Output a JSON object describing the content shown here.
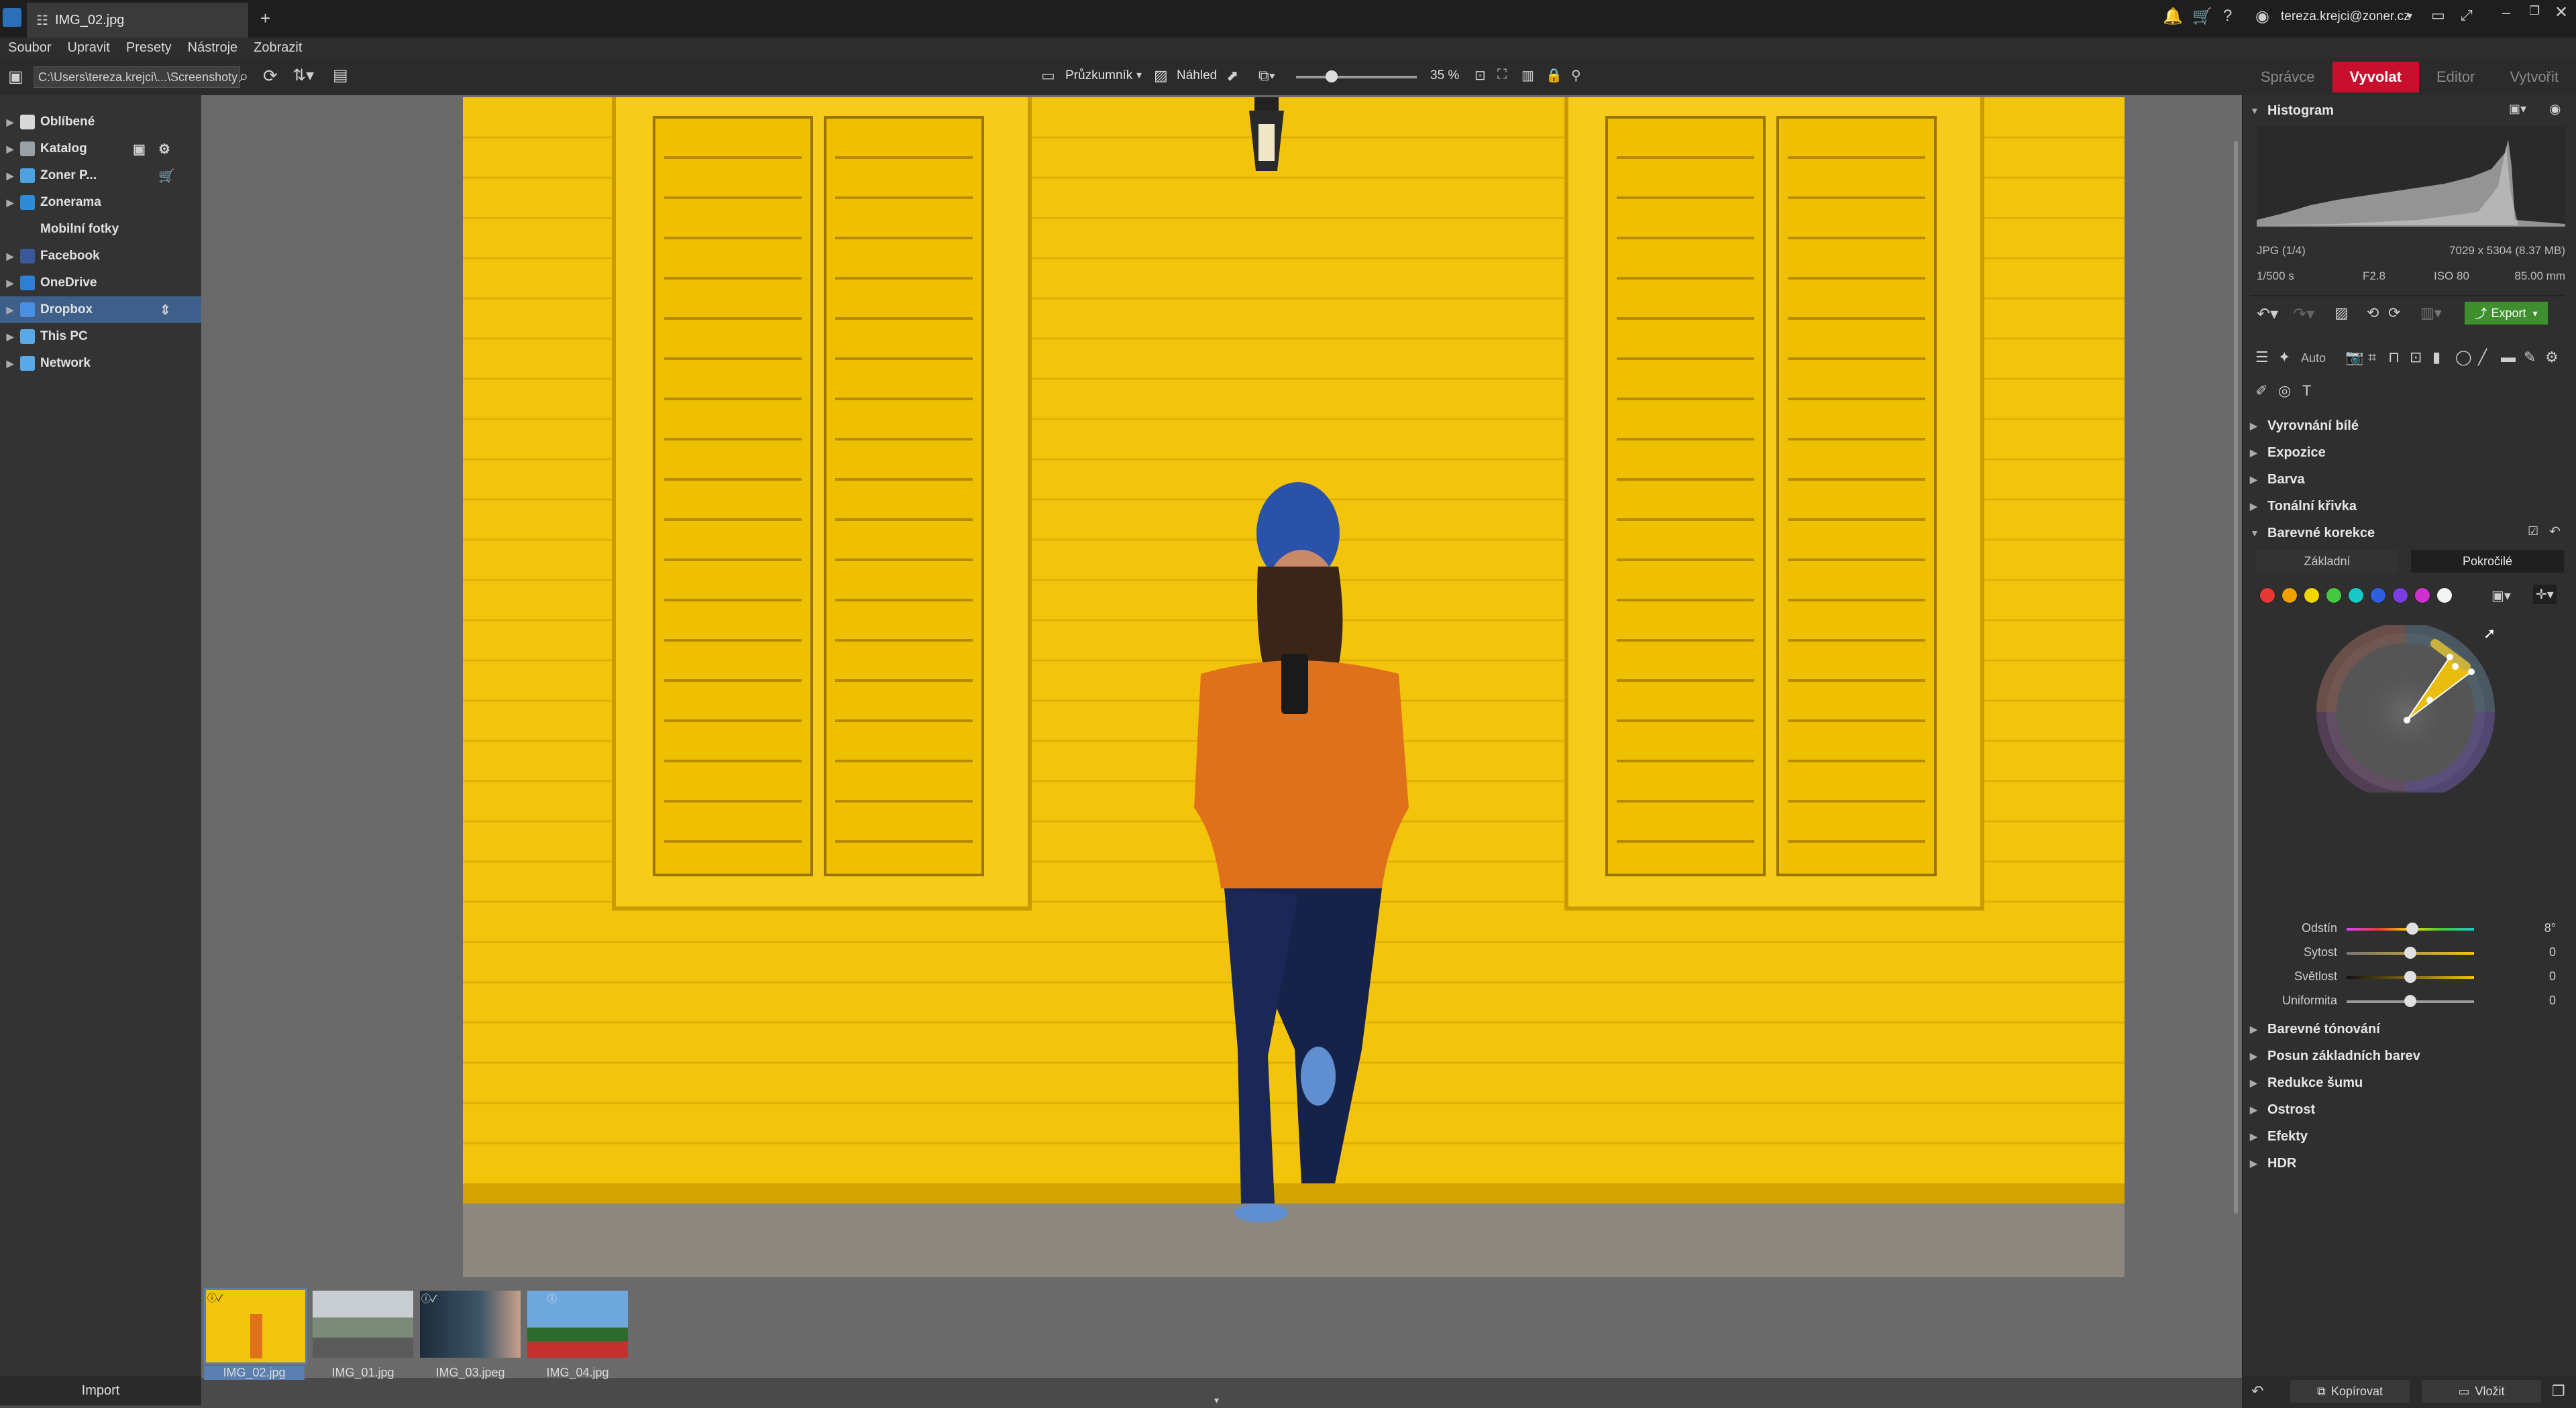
{
  "window": {
    "tab_title": "IMG_02.jpg",
    "user": "tereza.krejci@zoner.cz"
  },
  "menu": [
    "Soubor",
    "Upravit",
    "Presety",
    "Nástroje",
    "Zobrazit"
  ],
  "toolbar": {
    "path": "C:\\Users\\tereza.krejci\\...\\Screenshoty",
    "explorer_label": "Průzkumník",
    "preview_label": "Náhled",
    "zoom": "35 %"
  },
  "modes": [
    "Správce",
    "Vyvolat",
    "Editor",
    "Vytvořit"
  ],
  "sidebar": {
    "items": [
      {
        "label": "Oblíbené",
        "color": "#d9d9d9"
      },
      {
        "label": "Katalog",
        "color": "#9aa0a6"
      },
      {
        "label": "Zoner P...",
        "color": "#4da3e0"
      },
      {
        "label": "Zonerama",
        "color": "#2b8bd9"
      },
      {
        "label": "Mobilní fotky",
        "color": "#d9d9d9"
      },
      {
        "label": "Facebook",
        "color": "#3b5998"
      },
      {
        "label": "OneDrive",
        "color": "#2f7fd6"
      },
      {
        "label": "Dropbox",
        "color": "#4a90e2"
      },
      {
        "label": "This PC",
        "color": "#5aa9e6"
      },
      {
        "label": "Network",
        "color": "#5aa9e6"
      }
    ],
    "import_label": "Import"
  },
  "filmstrip": [
    {
      "name": "IMG_02.jpg",
      "selected": true
    },
    {
      "name": "IMG_01.jpg",
      "selected": false
    },
    {
      "name": "IMG_03.jpeg",
      "selected": false
    },
    {
      "name": "IMG_04.jpg",
      "selected": false
    }
  ],
  "histogram": {
    "title": "Histogram",
    "format": "JPG  (1/4)",
    "dimensions": "7029 x 5304 (8.37 MB)",
    "shutter": "1/500 s",
    "aperture": "F2.8",
    "iso": "ISO 80",
    "focal": "85.00 mm"
  },
  "actions": {
    "export_label": "Export",
    "auto_label": "Auto"
  },
  "sections": {
    "white_balance": "Vyrovnání bílé",
    "exposure": "Expozice",
    "color": "Barva",
    "tone_curve": "Tonální křivka",
    "color_correction": "Barevné korekce",
    "color_toning": "Barevné tónování",
    "shift": "Posun základních barev",
    "noise": "Redukce šumu",
    "sharpness": "Ostrost",
    "effects": "Efekty",
    "hdr": "HDR"
  },
  "color_correction": {
    "tab_basic": "Základní",
    "tab_advanced": "Pokročilé",
    "swatches": [
      "#e53935",
      "#f0a000",
      "#f2d600",
      "#44c840",
      "#18c8c8",
      "#2e5fe0",
      "#7a3de0",
      "#d030d0",
      "#f4f4f4"
    ],
    "sliders": [
      {
        "label": "Odstín",
        "value": "8°"
      },
      {
        "label": "Sytost",
        "value": "0"
      },
      {
        "label": "Světlost",
        "value": "0"
      },
      {
        "label": "Uniformita",
        "value": "0"
      }
    ]
  },
  "bottom": {
    "copy_label": "Kopírovat",
    "paste_label": "Vložit"
  },
  "colors": {
    "accent": "#c8102e",
    "export": "#3f8f2f",
    "wall": "#f2c40c"
  }
}
